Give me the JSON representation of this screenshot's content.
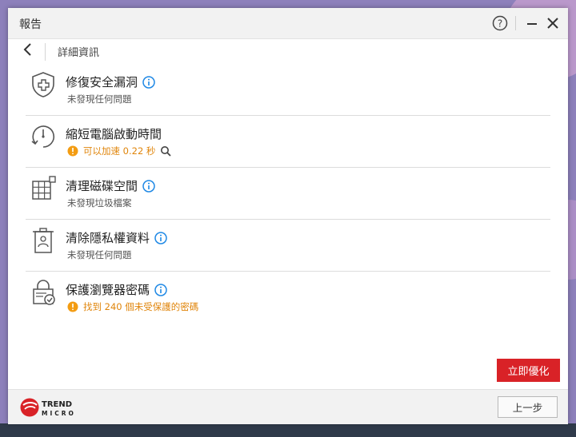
{
  "window": {
    "title": "報告"
  },
  "titlebar": {
    "help_icon": "help-icon",
    "minimize_icon": "minimize-icon",
    "close_icon": "close-icon"
  },
  "subheader": {
    "back_icon": "chevron-left-icon",
    "title": "詳細資訊"
  },
  "items": [
    {
      "title": "修復安全漏洞",
      "status": "未發現任何問題",
      "icon": "shield-repair-icon",
      "has_info": true,
      "warning": false
    },
    {
      "title": "縮短電腦啟動時間",
      "status": "可以加速 0.22 秒",
      "icon": "clock-icon",
      "has_info": false,
      "warning": true,
      "has_search": true
    },
    {
      "title": "清理磁碟空間",
      "status": "未發現垃圾檔案",
      "icon": "disk-grid-icon",
      "has_info": true,
      "warning": false
    },
    {
      "title": "清除隱私權資料",
      "status": "未發現任何問題",
      "icon": "trash-id-icon",
      "has_info": true,
      "warning": false
    },
    {
      "title": "保護瀏覽器密碼",
      "status": "找到 240 個未受保護的密碼",
      "icon": "lock-check-icon",
      "has_info": true,
      "warning": true
    }
  ],
  "actions": {
    "optimize_label": "立即優化",
    "prev_label": "上一步"
  },
  "footer": {
    "logo_line1": "TREND",
    "logo_line2": "MICRO"
  },
  "colors": {
    "accent_red": "#d92227",
    "info_blue": "#1e88e5",
    "warning_orange": "#f39c12"
  }
}
